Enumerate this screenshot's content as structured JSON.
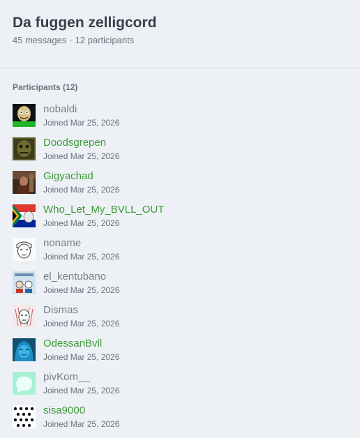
{
  "header": {
    "title": "Da fuggen zelligcord",
    "messages": "45 messages",
    "separator": "·",
    "participants": "12 participants"
  },
  "section_title": "Participants (12)",
  "colors": {
    "accent_name": "#3e9b3a",
    "muted_name": "#7a7f87",
    "background": "#edf1f5"
  },
  "members": [
    {
      "name": "nobaldi",
      "joined": "Joined Mar 25, 2026",
      "name_color": "muted",
      "avatar_icon": "bald-head-avatar"
    },
    {
      "name": "Doodsgrepen",
      "joined": "Joined Mar 25, 2026",
      "name_color": "accent",
      "avatar_icon": "dark-portrait-avatar"
    },
    {
      "name": "Gigyachad",
      "joined": "Joined Mar 25, 2026",
      "name_color": "accent",
      "avatar_icon": "painting-avatar"
    },
    {
      "name": "Who_Let_My_BVLL_OUT",
      "joined": "Joined Mar 25, 2026",
      "name_color": "accent",
      "avatar_icon": "flag-avatar"
    },
    {
      "name": "noname",
      "joined": "Joined Mar 25, 2026",
      "name_color": "muted",
      "avatar_icon": "sketch-face-avatar"
    },
    {
      "name": "el_kentubano",
      "joined": "Joined Mar 25, 2026",
      "name_color": "muted",
      "avatar_icon": "cartoon-avatar"
    },
    {
      "name": "Dismas",
      "joined": "Joined Mar 25, 2026",
      "name_color": "muted",
      "avatar_icon": "drawn-face-avatar"
    },
    {
      "name": "OdessanBvll",
      "joined": "Joined Mar 25, 2026",
      "name_color": "accent",
      "avatar_icon": "blue-anime-avatar"
    },
    {
      "name": "pivKom__",
      "joined": "Joined Mar 25, 2026",
      "name_color": "muted",
      "avatar_icon": "mint-blob-avatar"
    },
    {
      "name": "sisa9000",
      "joined": "Joined Mar 25, 2026",
      "name_color": "accent",
      "avatar_icon": "pattern-avatar"
    }
  ]
}
